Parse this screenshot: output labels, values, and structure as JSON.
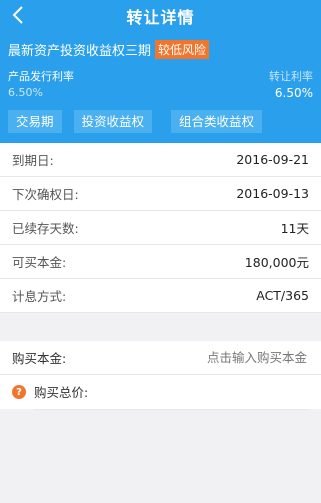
{
  "header": {
    "title": "转让详情",
    "product_name": "晨新资产投资收益权三期",
    "risk_badge": "较低风险",
    "issue_rate_label": "产品发行利率",
    "issue_rate_value": "6.50%",
    "transfer_rate_label": "转让利率",
    "transfer_rate_value": "6.50%",
    "chips": [
      "交易期",
      "投资收益权",
      "组合类收益权"
    ]
  },
  "details": [
    {
      "label": "到期日:",
      "value": "2016-09-21"
    },
    {
      "label": "下次确权日:",
      "value": "2016-09-13"
    },
    {
      "label": "已续存天数:",
      "value": "11天"
    },
    {
      "label": "可买本金:",
      "value": "180,000元"
    },
    {
      "label": "计息方式:",
      "value": "ACT/365"
    }
  ],
  "form": {
    "principal_label": "购买本金:",
    "principal_placeholder": "点击输入购买本金",
    "total_label": "购买总价:",
    "help_icon_glyph": "?"
  },
  "colors": {
    "header_bg": "#2aa0ec",
    "chip_bg": "#4ab0f0",
    "risk_badge_bg": "#f0762e"
  },
  "icons": {
    "back": "chevron-left-icon",
    "help": "question-icon"
  }
}
